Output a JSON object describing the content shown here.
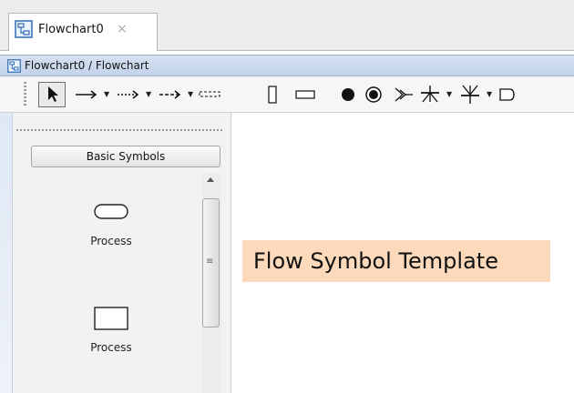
{
  "tab": {
    "title": "Flowchart0",
    "icon": "flowchart-doc-icon",
    "close_symbol": "×"
  },
  "window": {
    "title": "Flowchart0 / Flowchart",
    "icon": "flowchart-doc-icon"
  },
  "toolbar": {
    "tools": [
      "select-pointer-icon",
      "arrow-line-icon",
      "dotted-arrow-icon",
      "dashed-arrow-icon",
      "dashed-line-icon",
      "vertical-rect-icon",
      "horizontal-rect-icon",
      "filled-circle-icon",
      "double-circle-icon",
      "merge-arrow-icon",
      "fork-icon",
      "join-icon",
      "document-shape-icon"
    ],
    "dropdown_symbol": "▼"
  },
  "palette": {
    "category_label": "Basic Symbols",
    "items": [
      {
        "label": "Process",
        "shape": "rounded-rect"
      },
      {
        "label": "Process",
        "shape": "rectangle"
      }
    ]
  },
  "scrollbar": {
    "grip": "≡"
  },
  "canvas": {
    "template_label": "Flow Symbol Template"
  },
  "colors": {
    "accent": "#c2d2e9",
    "label_highlight": "#fdd9bb"
  }
}
